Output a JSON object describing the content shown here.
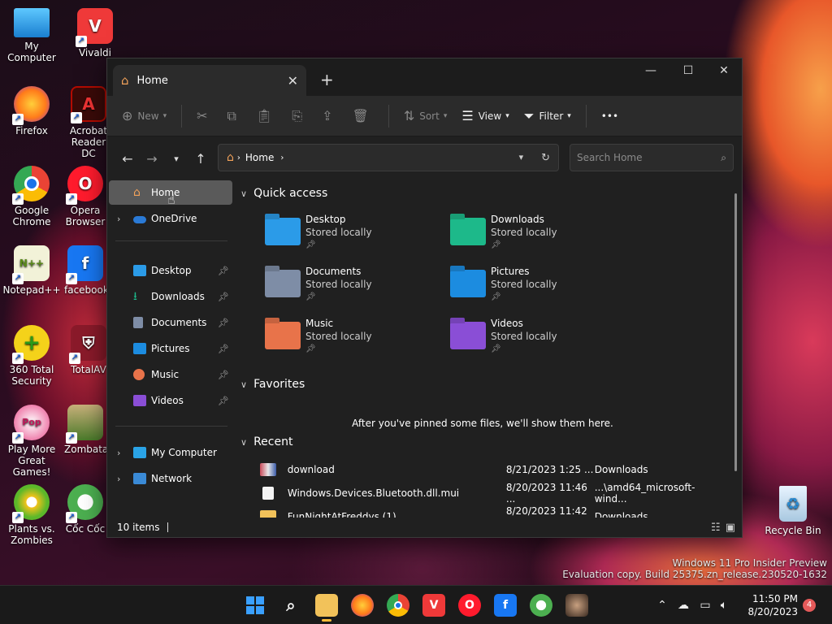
{
  "desktop": {
    "icons": [
      {
        "label": "My Computer",
        "icon": "monitor-icon",
        "color": "#2aa3e6"
      },
      {
        "label": "Vivaldi",
        "icon": "vivaldi-icon",
        "color": "#ef3939"
      },
      {
        "label": "Firefox",
        "icon": "firefox-icon",
        "color": "#ff7b1a"
      },
      {
        "label": "Acrobat Reader DC",
        "icon": "acrobat-icon",
        "color": "#b30b00"
      },
      {
        "label": "Google Chrome",
        "icon": "chrome-icon",
        "color": "#1a73e8"
      },
      {
        "label": "Opera Browser",
        "icon": "opera-icon",
        "color": "#ff1b2d"
      },
      {
        "label": "Notepad++",
        "icon": "notepadpp-icon",
        "color": "#7cc242"
      },
      {
        "label": "facebook",
        "icon": "facebook-icon",
        "color": "#1877f2"
      },
      {
        "label": "360 Total Security",
        "icon": "shield-plus-icon",
        "color": "#7ac70c"
      },
      {
        "label": "TotalAV",
        "icon": "totalav-icon",
        "color": "#d6243a"
      },
      {
        "label": "Play More Great Games!",
        "icon": "popcap-icon",
        "color": "#e84a8a"
      },
      {
        "label": "Zombata",
        "icon": "zombata-icon",
        "color": "#4a7a2a"
      },
      {
        "label": "Plants vs. Zombies",
        "icon": "pvz-icon",
        "color": "#5cb82a"
      },
      {
        "label": "Cốc Cốc",
        "icon": "coccoc-icon",
        "color": "#4caf50"
      }
    ],
    "recycle_bin": "Recycle Bin",
    "watermark_line1": "Windows 11 Pro Insider Preview",
    "watermark_line2": "Evaluation copy. Build 25375.zn_release.230520-1632"
  },
  "window": {
    "tab_title": "Home",
    "tab_close": "✕",
    "new_tab": "+",
    "controls": {
      "minimize": "—",
      "maximize": "☐",
      "close": "✕"
    },
    "toolbar": {
      "new": "New",
      "sort": "Sort",
      "view": "View",
      "filter": "Filter",
      "more": "•••"
    },
    "address": {
      "crumb": "Home",
      "search_placeholder": "Search Home"
    },
    "sidebar": {
      "home": "Home",
      "onedrive": "OneDrive",
      "pinned": [
        "Desktop",
        "Downloads",
        "Documents",
        "Pictures",
        "Music",
        "Videos"
      ],
      "my_computer": "My Computer",
      "network": "Network"
    },
    "quick_access": {
      "heading": "Quick access",
      "items": [
        {
          "name": "Desktop",
          "sub": "Stored locally",
          "color": "#2b9be8"
        },
        {
          "name": "Downloads",
          "sub": "Stored locally",
          "color": "#1db98a"
        },
        {
          "name": "Documents",
          "sub": "Stored locally",
          "color": "#7e8da6"
        },
        {
          "name": "Pictures",
          "sub": "Stored locally",
          "color": "#1c8ce0"
        },
        {
          "name": "Music",
          "sub": "Stored locally",
          "color": "#e8734a"
        },
        {
          "name": "Videos",
          "sub": "Stored locally",
          "color": "#8a4ed6"
        }
      ]
    },
    "favorites": {
      "heading": "Favorites",
      "empty": "After you've pinned some files, we'll show them here."
    },
    "recent": {
      "heading": "Recent",
      "rows": [
        {
          "name": "download",
          "date": "8/21/2023 1:25 ...",
          "location": "Downloads"
        },
        {
          "name": "Windows.Devices.Bluetooth.dll.mui",
          "date": "8/20/2023 11:46 ...",
          "location": "...\\amd64_microsoft-wind..."
        },
        {
          "name": "FunNightAtFreddys (1)",
          "date": "8/20/2023 11:42 ...",
          "location": "Downloads"
        }
      ]
    },
    "status": "10 items"
  },
  "taskbar": {
    "time": "11:50 PM",
    "date": "8/20/2023",
    "notifications": "4"
  }
}
